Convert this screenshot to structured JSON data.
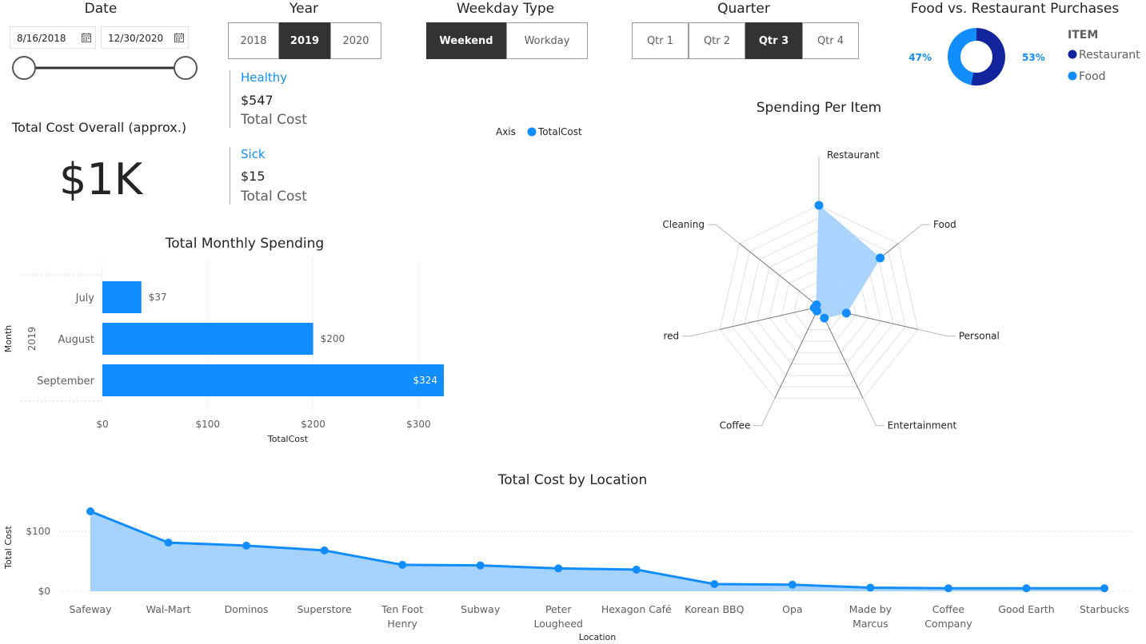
{
  "date_slicer": {
    "title": "Date",
    "start": "8/16/2018",
    "end": "12/30/2020",
    "start_icon": "calendar-icon",
    "end_icon": "calendar-icon"
  },
  "year_slicer": {
    "title": "Year",
    "options": [
      "2018",
      "2019",
      "2020"
    ],
    "selected": "2019"
  },
  "weekday_slicer": {
    "title": "Weekday Type",
    "options": [
      "Weekend",
      "Workday"
    ],
    "selected": "Weekend"
  },
  "quarter_slicer": {
    "title": "Quarter",
    "options": [
      "Qtr 1",
      "Qtr 2",
      "Qtr 3",
      "Qtr 4"
    ],
    "selected": "Qtr 3"
  },
  "total_card": {
    "title": "Total Cost Overall (approx.)",
    "value": "$1K"
  },
  "multi_card": [
    {
      "label": "Healthy",
      "value": "$547",
      "sub": "Total Cost"
    },
    {
      "label": "Sick",
      "value": "$15",
      "sub": "Total Cost"
    }
  ],
  "colors": {
    "accent": "#118dff",
    "dark_blue": "#12239e",
    "light_fill": "#a6d2ff",
    "selected_tile": "#333333"
  },
  "chart_data": [
    {
      "type": "pie",
      "title": "Food vs. Restaurant Purchases",
      "legend_title": "ITEM",
      "legend_position": "right",
      "slices": [
        {
          "name": "Restaurant",
          "value": 53,
          "label": "53%",
          "color": "#12239e"
        },
        {
          "name": "Food",
          "value": 47,
          "label": "47%",
          "color": "#118dff"
        }
      ]
    },
    {
      "type": "radar",
      "title": "Spending Per Item",
      "legend_title": "Axis",
      "legend_position": "top",
      "series": [
        {
          "name": "TotalCost",
          "values": [
            324,
            250,
            90,
            40,
            15,
            15,
            10
          ]
        }
      ],
      "categories": [
        "Restaurant",
        "Food",
        "Personal",
        "Entertainment",
        "Coffee",
        "red",
        "Cleaning"
      ],
      "rmax": 324
    },
    {
      "type": "bar",
      "orientation": "horizontal",
      "title": "Total Monthly Spending",
      "xlabel": "TotalCost",
      "ylabel": "Month",
      "group_label": "2019",
      "categories": [
        "July",
        "August",
        "September"
      ],
      "values": [
        37,
        200,
        324
      ],
      "data_labels": [
        "$37",
        "$200",
        "$324"
      ],
      "xticks": [
        "$0",
        "$100",
        "$200",
        "$300"
      ],
      "xlim": [
        0,
        324
      ]
    },
    {
      "type": "area",
      "title": "Total Cost by Location",
      "xlabel": "Location",
      "ylabel": "Total Cost",
      "categories": [
        "Safeway",
        "Wal-Mart",
        "Dominos",
        "Superstore",
        "Ten Foot Henry",
        "Subway",
        "Peter Lougheed",
        "Hexagon Café",
        "Korean BBQ",
        "Opa",
        "Made by Marcus",
        "Coffee Company",
        "Good Earth",
        "Starbucks"
      ],
      "category_lines": [
        [
          "Safeway"
        ],
        [
          "Wal-Mart"
        ],
        [
          "Dominos"
        ],
        [
          "Superstore"
        ],
        [
          "Ten Foot",
          "Henry"
        ],
        [
          "Subway"
        ],
        [
          "Peter",
          "Lougheed"
        ],
        [
          "Hexagon Café"
        ],
        [
          "Korean BBQ"
        ],
        [
          "Opa"
        ],
        [
          "Made by",
          "Marcus"
        ],
        [
          "Coffee",
          "Company"
        ],
        [
          "Good Earth"
        ],
        [
          "Starbucks"
        ]
      ],
      "values": [
        133,
        81,
        76,
        68,
        44,
        43,
        38,
        36,
        12,
        11,
        6,
        5,
        5,
        5
      ],
      "yticks": [
        "$0",
        "$100"
      ],
      "ylim": [
        0,
        133
      ]
    }
  ]
}
